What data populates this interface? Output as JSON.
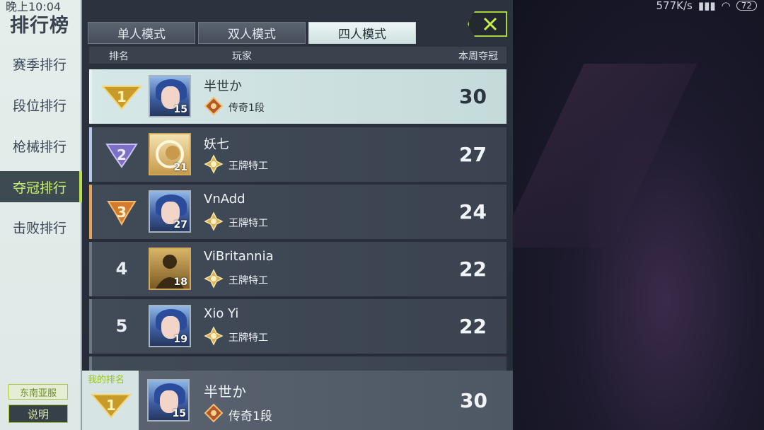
{
  "status": {
    "time": "晚上10:04",
    "network": "577K/s",
    "battery": "72"
  },
  "sidebar": {
    "title": "排行榜",
    "items": [
      {
        "label": "赛季排行",
        "active": false
      },
      {
        "label": "段位排行",
        "active": false
      },
      {
        "label": "枪械排行",
        "active": false
      },
      {
        "label": "夺冠排行",
        "active": true
      },
      {
        "label": "击败排行",
        "active": false
      }
    ],
    "server": "东南亚服",
    "help_label": "说明"
  },
  "tabs": [
    {
      "label": "单人模式",
      "active": false
    },
    {
      "label": "双人模式",
      "active": false
    },
    {
      "label": "四人模式",
      "active": true
    }
  ],
  "table": {
    "headers": {
      "rank": "排名",
      "player": "玩家",
      "weekly_wins": "本周夺冠"
    },
    "rows": [
      {
        "rank": "1",
        "name": "半世か",
        "level": "15",
        "tier": "传奇1段",
        "wins": "30",
        "avatar": "blue-hair"
      },
      {
        "rank": "2",
        "name": "妖七",
        "level": "21",
        "tier": "王牌特工",
        "wins": "27",
        "avatar": "gold-emblem"
      },
      {
        "rank": "3",
        "name": "VnAdd",
        "level": "27",
        "tier": "王牌特工",
        "wins": "24",
        "avatar": "blue-hair"
      },
      {
        "rank": "4",
        "name": "ViBritannia",
        "level": "18",
        "tier": "王牌特工",
        "wins": "22",
        "avatar": "silhouette"
      },
      {
        "rank": "5",
        "name": "Xio Yi",
        "level": "19",
        "tier": "王牌特工",
        "wins": "22",
        "avatar": "blue-hair"
      }
    ]
  },
  "my_rank": {
    "label": "我的排名",
    "rank": "1",
    "name": "半世か",
    "level": "15",
    "tier": "传奇1段",
    "wins": "30"
  },
  "colors": {
    "accent": "#a7d43a",
    "active_tab": "#e6f1f1",
    "row_bg": "#404955",
    "first_row_bg": "#d2e4e4"
  },
  "icons": [
    "close-icon",
    "rank-1-badge-icon",
    "rank-2-badge-icon",
    "rank-3-badge-icon",
    "legend-tier-icon",
    "ace-agent-tier-icon"
  ]
}
